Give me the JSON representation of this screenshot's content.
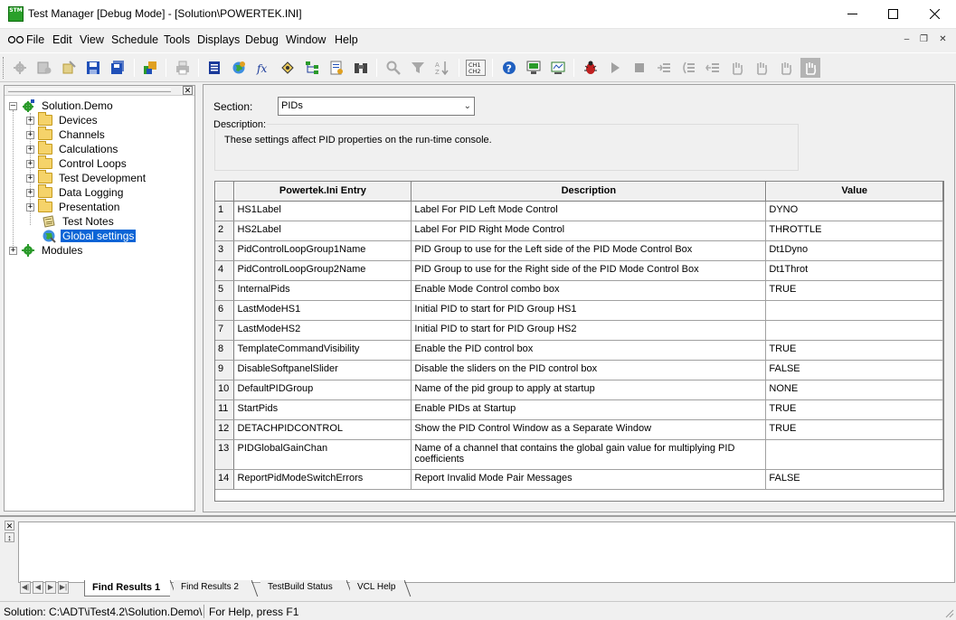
{
  "window": {
    "title": "Test Manager [Debug Mode] - [Solution\\POWERTEK.INI]",
    "icon_label": "STM",
    "controls": [
      "minimize-icon",
      "maximize-icon",
      "close-icon"
    ]
  },
  "menu": {
    "items": [
      "File",
      "Edit",
      "View",
      "Schedule",
      "Tools",
      "Displays",
      "Debug",
      "Window",
      "Help"
    ],
    "mdi_controls": [
      "minimize-icon",
      "restore-icon",
      "close-icon"
    ]
  },
  "toolbar": {
    "icons": [
      "build-icon",
      "build-all-icon",
      "clean-icon",
      "save-icon",
      "save-all-icon",
      "deploy-icon",
      "print-icon",
      "document-icon",
      "globe-icon",
      "function-icon",
      "channels-icon",
      "tree-icon",
      "report-icon",
      "binoculars-icon",
      "search-icon",
      "filter-icon",
      "sort-icon",
      "channel-swap-icon",
      "help-icon",
      "screen-icon",
      "monitor-icon",
      "debug-bug-icon",
      "run-icon",
      "stop-icon",
      "step-into-icon",
      "step-over-icon",
      "step-out-icon",
      "hand-icon",
      "hand2-icon",
      "hand3-icon",
      "hand4-icon"
    ],
    "channel_swap_label_top": "CH1",
    "channel_swap_label_bottom": "CH2"
  },
  "tree": {
    "root": "Solution.Demo",
    "children": [
      "Devices",
      "Channels",
      "Calculations",
      "Control Loops",
      "Test Development",
      "Data Logging",
      "Presentation"
    ],
    "test_notes": "Test Notes",
    "selected": "Global settings",
    "modules": "Modules"
  },
  "section": {
    "label": "Section:",
    "value": "PIDs",
    "description_title": "Description:",
    "description": "These settings affect PID properties on the run-time console."
  },
  "grid": {
    "columns": [
      "Powertek.Ini Entry",
      "Description",
      "Value"
    ],
    "rows": [
      {
        "num": "1",
        "entry": "HS1Label",
        "description": "Label For PID Left Mode Control",
        "value": "DYNO"
      },
      {
        "num": "2",
        "entry": "HS2Label",
        "description": "Label For PID Right Mode Control",
        "value": "THROTTLE"
      },
      {
        "num": "3",
        "entry": "PidControlLoopGroup1Name",
        "description": "PID Group to use for the Left side of the PID Mode Control Box",
        "value": "Dt1Dyno"
      },
      {
        "num": "4",
        "entry": "PidControlLoopGroup2Name",
        "description": "PID Group to use for the Right side of the PID Mode Control Box",
        "value": "Dt1Throt"
      },
      {
        "num": "5",
        "entry": "InternalPids",
        "description": "Enable Mode Control combo box",
        "value": "TRUE"
      },
      {
        "num": "6",
        "entry": "LastModeHS1",
        "description": "Initial PID to start for PID Group HS1",
        "value": ""
      },
      {
        "num": "7",
        "entry": "LastModeHS2",
        "description": "Initial PID to start for PID Group HS2",
        "value": ""
      },
      {
        "num": "8",
        "entry": "TemplateCommandVisibility",
        "description": "Enable the PID control box",
        "value": "TRUE"
      },
      {
        "num": "9",
        "entry": "DisableSoftpanelSlider",
        "description": "Disable the sliders on the PID control box",
        "value": "FALSE"
      },
      {
        "num": "10",
        "entry": "DefaultPIDGroup",
        "description": "Name of the pid group to apply at startup",
        "value": "NONE"
      },
      {
        "num": "11",
        "entry": "StartPids",
        "description": "Enable PIDs at Startup",
        "value": "TRUE"
      },
      {
        "num": "12",
        "entry": "DETACHPIDCONTROL",
        "description": "Show the PID Control Window as a Separate Window",
        "value": "TRUE"
      },
      {
        "num": "13",
        "entry": "PIDGlobalGainChan",
        "description": "Name of a channel that contains the global gain value for multiplying PID coefficients",
        "value": ""
      },
      {
        "num": "14",
        "entry": "ReportPidModeSwitchErrors",
        "description": "Report Invalid Mode Pair Messages",
        "value": "FALSE"
      }
    ]
  },
  "bottom": {
    "tabs": [
      "Find Results 1",
      "Find Results 2",
      "TestBuild Status",
      "VCL Help"
    ]
  },
  "status": {
    "path": "Solution: C:\\ADT\\iTest4.2\\Solution.Demo\\",
    "help": "For Help, press F1"
  }
}
